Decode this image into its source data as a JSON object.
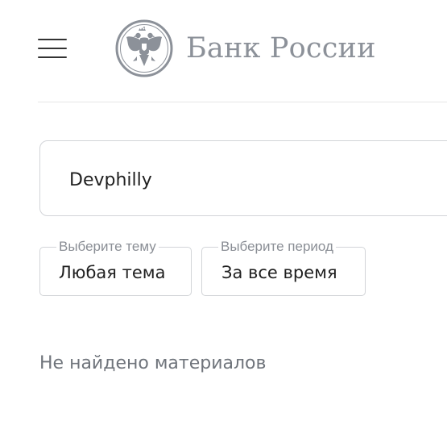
{
  "header": {
    "menu_icon": "hamburger-menu-icon",
    "logo_icon": "double-headed-eagle-emblem-icon",
    "logo_text": "Банк России",
    "logo_color": "#8c9199"
  },
  "search": {
    "value": "Devphilly"
  },
  "filters": {
    "theme": {
      "legend": "Выберите тему",
      "value": "Любая тема"
    },
    "period": {
      "legend": "Выберите период",
      "value": "За все время"
    }
  },
  "results": {
    "empty_message": "Не найдено материалов"
  }
}
